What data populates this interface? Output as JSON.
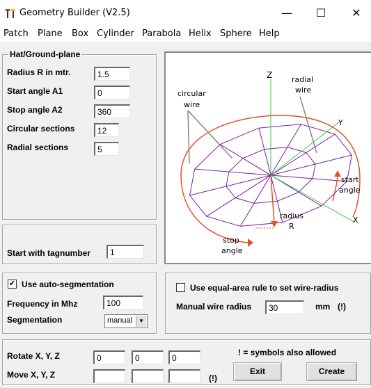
{
  "window": {
    "title": "Geometry Builder (V2.5)",
    "minimize": "—",
    "maximize": "☐",
    "close": "✕"
  },
  "menu": [
    "Patch",
    "Plane",
    "Box",
    "Cylinder",
    "Parabola",
    "Helix",
    "Sphere",
    "Help"
  ],
  "hat_group": {
    "title": "Hat/Ground-plane",
    "radius": {
      "label": "Radius R in mtr.",
      "value": "1.5"
    },
    "start_angle": {
      "label": "Start angle A1",
      "value": "0"
    },
    "stop_angle": {
      "label": "Stop angle A2",
      "value": "360"
    },
    "circular_sections": {
      "label": "Circular sections",
      "value": "12"
    },
    "radial_sections": {
      "label": "Radial sections",
      "value": "5"
    }
  },
  "tag": {
    "label": "Start with tagnumber",
    "value": "1"
  },
  "diagram": {
    "circular_wire": [
      "circular",
      "wire"
    ],
    "radial_wire": [
      "radial",
      "wire"
    ],
    "start_angle": [
      "start",
      "angle"
    ],
    "radius": [
      "radius",
      "R"
    ],
    "stop_angle": [
      "stop",
      "angle"
    ],
    "axis_z": "Z",
    "axis_y": "Y",
    "axis_x": "X",
    "colors": {
      "wire": "#7b1fa2",
      "arrow": "#e0522b",
      "axis_green": "#2ecc40",
      "gray": "#808080"
    }
  },
  "segmentation": {
    "auto_checked": true,
    "auto_label": "Use auto-segmentation",
    "frequency": {
      "label": "Frequency in Mhz",
      "value": "100"
    },
    "segmentation": {
      "label": "Segmentation",
      "value": "manual"
    }
  },
  "wire_radius": {
    "equal_area_checked": false,
    "equal_area_label": "Use equal-area rule to set wire-radius",
    "manual": {
      "label": "Manual wire radius",
      "value": "30",
      "unit": "mm",
      "note": "(!)"
    }
  },
  "transform": {
    "note": "! =  symbols also allowed",
    "rotate": {
      "label": "Rotate X, Y, Z",
      "values": [
        "0",
        "0",
        "0"
      ]
    },
    "move": {
      "label": "Move X, Y, Z",
      "values": [
        "",
        "",
        ""
      ],
      "note": "(!)"
    },
    "exit": "Exit",
    "create": "Create"
  }
}
